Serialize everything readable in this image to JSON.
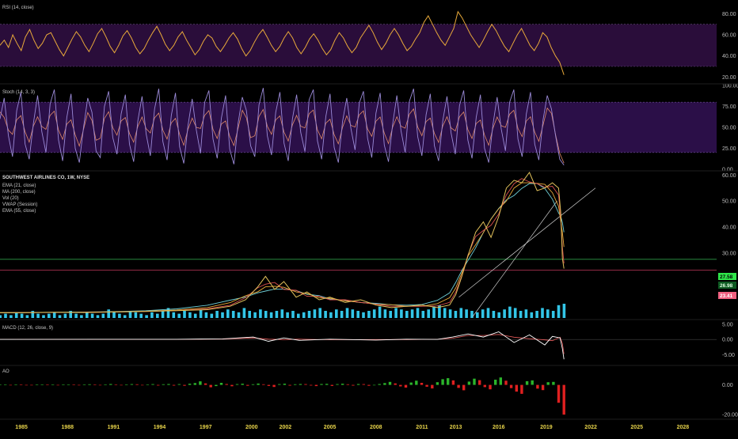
{
  "colors": {
    "background": "#000000",
    "pane_border": "#1e1e1e",
    "rsi_band": "#2a0d3a",
    "stoch_band": "#2b0f48",
    "rsi_line": "#e8a93a",
    "stoch_k": "#9b8ad8",
    "stoch_d": "#e08a6a",
    "price": "#e0c05a",
    "ema21": "#d94f4f",
    "ma200": "#6fd0d8",
    "vol": "#33c6e8",
    "vwap": "#e8e8e8",
    "ema55": "#e8a93a",
    "trendline": "#cfcfcf",
    "hline_green": "#2e9b47",
    "hline_red": "#c0395c",
    "macd": "#ffffff",
    "signal": "#e65a5a",
    "ao_up": "#2bb52b",
    "ao_down": "#e02020",
    "year_text": "#e8d44a",
    "tag_green": "#2fe64a",
    "tag_red": "#f06080"
  },
  "panes": {
    "rsi": {
      "title": "RSI (14, close)"
    },
    "stoch": {
      "title": "Stoch (14, 3, 3)"
    },
    "price": {
      "title": "SOUTHWEST AIRLINES CO, 1W, NYSE",
      "legend": [
        "EMA (21, close)",
        "MA (200, close)",
        "Vol (20)",
        "VWAP (Session)",
        "EMA (55, close)"
      ]
    },
    "macd": {
      "title": "MACD (12, 26, close, 9)"
    },
    "ao": {
      "title": "AO"
    }
  },
  "price_tags": [
    {
      "text": "27.58",
      "kind": "green"
    },
    {
      "text": "26.98",
      "kind": "green_dark"
    },
    {
      "text": "23.41",
      "kind": "red"
    }
  ],
  "chart_data": [
    {
      "type": "line",
      "name": "rsi",
      "ylim": [
        15,
        90
      ],
      "ticks": [
        "80.00",
        "60.00",
        "40.00",
        "20.00"
      ],
      "tick_values": [
        80,
        60,
        40,
        20
      ],
      "band": [
        30,
        70
      ],
      "x_start": 1983.5,
      "x_end": 2020.25,
      "values": [
        50,
        55,
        48,
        60,
        52,
        45,
        58,
        65,
        55,
        47,
        52,
        60,
        62,
        54,
        46,
        40,
        48,
        56,
        63,
        58,
        50,
        44,
        52,
        61,
        66,
        58,
        49,
        43,
        50,
        59,
        64,
        57,
        48,
        42,
        47,
        55,
        62,
        68,
        60,
        51,
        45,
        50,
        58,
        63,
        55,
        48,
        41,
        46,
        54,
        60,
        57,
        49,
        44,
        50,
        57,
        62,
        56,
        47,
        40,
        45,
        53,
        60,
        65,
        58,
        50,
        44,
        49,
        57,
        63,
        57,
        48,
        42,
        48,
        56,
        61,
        55,
        47,
        41,
        46,
        55,
        62,
        57,
        49,
        43,
        48,
        57,
        63,
        69,
        62,
        53,
        46,
        52,
        60,
        66,
        60,
        52,
        45,
        49,
        56,
        62,
        72,
        78,
        70,
        62,
        55,
        50,
        58,
        66,
        82,
        76,
        68,
        60,
        54,
        48,
        55,
        63,
        70,
        64,
        56,
        49,
        44,
        52,
        60,
        66,
        58,
        50,
        45,
        52,
        62,
        58,
        48,
        40,
        34,
        22
      ]
    },
    {
      "type": "line",
      "name": "stoch",
      "ylim": [
        0,
        100
      ],
      "ticks": [
        "100.00",
        "75.00",
        "50.00",
        "25.00",
        "0.00"
      ],
      "tick_values": [
        100,
        75,
        50,
        25,
        0
      ],
      "band": [
        20,
        80
      ],
      "x_start": 1983.5,
      "x_end": 2020.25,
      "values": [
        60,
        85,
        40,
        15,
        70,
        92,
        30,
        12,
        55,
        88,
        45,
        20,
        78,
        95,
        35,
        10,
        62,
        90,
        25,
        8,
        50,
        85,
        68,
        22,
        14,
        75,
        93,
        38,
        18,
        66,
        89,
        30,
        9,
        58,
        87,
        42,
        16,
        72,
        96,
        33,
        11,
        64,
        91,
        27,
        7,
        52,
        84,
        47,
        19,
        80,
        94,
        36,
        13,
        61,
        88,
        24,
        6,
        55,
        86,
        70,
        28,
        15,
        77,
        97,
        40,
        17,
        68,
        92,
        31,
        10,
        60,
        89,
        44,
        21,
        83,
        95,
        34,
        12,
        63,
        90,
        26,
        8,
        57,
        85,
        49,
        23,
        79,
        93,
        37,
        14,
        67,
        91,
        29,
        9,
        54,
        88,
        46,
        20,
        81,
        96,
        39,
        16,
        65,
        90,
        28,
        10,
        58,
        87,
        43,
        18,
        76,
        94,
        35,
        13,
        62,
        89,
        25,
        8,
        53,
        86,
        48,
        22,
        80,
        95,
        36,
        15,
        66,
        92,
        30,
        11,
        59,
        88,
        72,
        40,
        12,
        5
      ]
    },
    {
      "type": "line",
      "name": "price",
      "ylim": [
        5,
        61
      ],
      "ticks": [
        "60.00",
        "50.00",
        "40.00",
        "30.00"
      ],
      "tick_values": [
        60,
        50,
        40,
        30
      ],
      "x_start": 1983.5,
      "x_end": 2020.25,
      "hlines": [
        27.58,
        23.41
      ],
      "x": [
        1983.5,
        1985,
        1987,
        1989,
        1991,
        1993,
        1995,
        1997,
        1998.5,
        1999.5,
        2000.3,
        2000.8,
        2001.4,
        2002.0,
        2002.8,
        2003.5,
        2004.3,
        2005.0,
        2006.0,
        2007.0,
        2008.0,
        2009.0,
        2010.0,
        2011.0,
        2012.0,
        2012.8,
        2013.2,
        2013.6,
        2014.0,
        2014.5,
        2015.0,
        2015.5,
        2016.0,
        2016.5,
        2017.0,
        2017.5,
        2018.0,
        2018.5,
        2019.0,
        2019.5,
        2019.9,
        2020.05,
        2020.15,
        2020.25
      ],
      "values": [
        7,
        7,
        7.2,
        7.1,
        7.3,
        7.5,
        7.8,
        8.2,
        9.5,
        12,
        17,
        21,
        16,
        19,
        13,
        15,
        12,
        13,
        11,
        12,
        10,
        9,
        9.5,
        10,
        9,
        10,
        14,
        21,
        29,
        38,
        42,
        36,
        44,
        55,
        58,
        57,
        61,
        54,
        55,
        57,
        55,
        45,
        28,
        24
      ]
    },
    {
      "type": "line",
      "name": "macd",
      "ylim": [
        -8,
        6
      ],
      "ticks": [
        "5.00",
        "0.00",
        "-5.00"
      ],
      "tick_values": [
        5,
        0,
        -5
      ],
      "x_start": 1983.5,
      "x_end": 2020.25,
      "x": [
        1983.5,
        1995,
        1998,
        2000,
        2001,
        2002,
        2003,
        2005,
        2008,
        2010,
        2012,
        2013,
        2014,
        2015,
        2016,
        2017,
        2018,
        2019,
        2019.5,
        2020.0,
        2020.15,
        2020.25
      ],
      "values": [
        0,
        0.05,
        0.2,
        0.8,
        -0.6,
        0.5,
        -0.3,
        0.1,
        -0.2,
        0.1,
        0,
        0.8,
        1.8,
        0.8,
        2.5,
        -1.0,
        1.5,
        -1.8,
        1.0,
        0.5,
        -3.0,
        -6.5
      ]
    },
    {
      "type": "bar",
      "name": "ao",
      "ylim": [
        -22,
        12
      ],
      "ticks": [
        "0.00",
        "-20.00"
      ],
      "tick_values": [
        0,
        -20
      ],
      "x_start": 1983.5,
      "x_end": 2020.25,
      "values": [
        0.1,
        0.1,
        -0.1,
        0.2,
        0.1,
        0,
        -0.2,
        0.1,
        0.2,
        0.1,
        0.1,
        -0.1,
        0.2,
        0.3,
        0.1,
        -0.2,
        0.2,
        0.4,
        0.2,
        -0.3,
        0.3,
        0.6,
        0.3,
        -0.3,
        0.2,
        0.5,
        0.4,
        -0.2,
        0.3,
        0.5,
        -0.4,
        0.4,
        0.6,
        -0.5,
        0.5,
        -0.6,
        0.8,
        1.2,
        2.4,
        1.0,
        -1.6,
        -0.8,
        1.4,
        0.6,
        -0.9,
        0.5,
        0.8,
        -0.6,
        0.4,
        0.9,
        0.4,
        -0.7,
        -1.4,
        0.5,
        0.8,
        -0.5,
        0.4,
        0.6,
        0.5,
        -0.4,
        -0.8,
        0.6,
        0.7,
        -0.7,
        0.5,
        0.8,
        0.4,
        -0.5,
        0.6,
        0.5,
        -0.6,
        -0.3,
        0.6,
        1.2,
        2.0,
        1.0,
        -1.0,
        -1.8,
        1.6,
        2.8,
        1.4,
        -1.2,
        -2.4,
        1.8,
        3.8,
        4.5,
        3.0,
        -2.0,
        -3.6,
        2.2,
        4.2,
        3.2,
        -1.5,
        -3.0,
        3.5,
        5.0,
        2.8,
        -2.2,
        -4.5,
        -6.0,
        2.5,
        3.0,
        -2.5,
        -3.5,
        1.8,
        2.0,
        -12,
        -20
      ]
    },
    {
      "type": "bar",
      "name": "volume",
      "ylim": [
        0,
        10
      ],
      "x_start": 1983.5,
      "x_end": 2020.25,
      "values": [
        2,
        3,
        2,
        4,
        3,
        2,
        5,
        3,
        2,
        3,
        4,
        2,
        3,
        5,
        3,
        2,
        4,
        3,
        2,
        3,
        6,
        4,
        3,
        2,
        5,
        4,
        3,
        2,
        4,
        3,
        5,
        7,
        4,
        3,
        5,
        4,
        3,
        6,
        4,
        3,
        5,
        4,
        6,
        5,
        4,
        7,
        5,
        4,
        6,
        5,
        4,
        5,
        6,
        4,
        5,
        3,
        4,
        5,
        6,
        7,
        5,
        4,
        6,
        5,
        7,
        6,
        5,
        4,
        5,
        6,
        8,
        6,
        5,
        7,
        6,
        5,
        6,
        7,
        5,
        6,
        8,
        9,
        7,
        6,
        5,
        7,
        6,
        5,
        4,
        6,
        7,
        5,
        4,
        6,
        8,
        7,
        5,
        6,
        4,
        5,
        7,
        6,
        5,
        9,
        10
      ]
    }
  ],
  "x_axis": {
    "x_min": 1983.5,
    "x_max": 2030.2,
    "years": [
      {
        "label": "1985",
        "year": 1984.9
      },
      {
        "label": "1988",
        "year": 1987.9
      },
      {
        "label": "1991",
        "year": 1990.9
      },
      {
        "label": "1994",
        "year": 1993.9
      },
      {
        "label": "1997",
        "year": 1996.9
      },
      {
        "label": "2000",
        "year": 1999.9
      },
      {
        "label": "2002",
        "year": 2002.1
      },
      {
        "label": "2005",
        "year": 2005.0
      },
      {
        "label": "2008",
        "year": 2008.0
      },
      {
        "label": "2011",
        "year": 2011.0
      },
      {
        "label": "2013",
        "year": 2013.2
      },
      {
        "label": "2016",
        "year": 2016.0
      },
      {
        "label": "2019",
        "year": 2019.1
      },
      {
        "label": "2022",
        "year": 2022.0
      },
      {
        "label": "2025",
        "year": 2025.0
      },
      {
        "label": "2028",
        "year": 2028.0
      }
    ]
  }
}
